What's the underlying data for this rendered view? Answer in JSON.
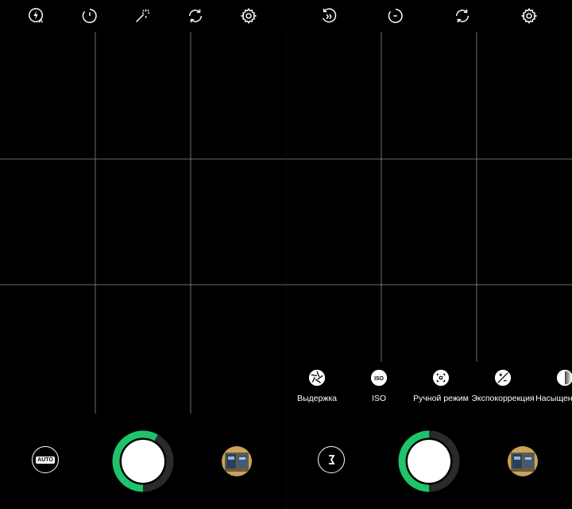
{
  "left_panel": {
    "top_icons": [
      "flash-auto-icon",
      "timer-icon",
      "magic-wand-icon",
      "switch-camera-icon",
      "settings-gear-icon"
    ],
    "auto_label": "AUTO",
    "progress": 0.58,
    "colors": {
      "ring_fill": "#1ec36a",
      "ring_track": "#2a2a2a"
    }
  },
  "right_panel": {
    "top_icons": [
      "hdr-toggle-icon",
      "timer-off-icon",
      "switch-camera-icon",
      "settings-gear-icon"
    ],
    "modes": [
      {
        "label": "Выдержка",
        "icon": "aperture-icon"
      },
      {
        "label": "ISO",
        "icon": "iso-icon"
      },
      {
        "label": "Ручной режим",
        "icon": "manual-focus-icon"
      },
      {
        "label": "Экспокоррекция",
        "icon": "exposure-icon"
      },
      {
        "label": "Насыщенность",
        "icon": "saturation-icon"
      }
    ],
    "progress": 0.5,
    "colors": {
      "ring_fill": "#1ec36a",
      "ring_track": "#2a2a2a"
    }
  }
}
